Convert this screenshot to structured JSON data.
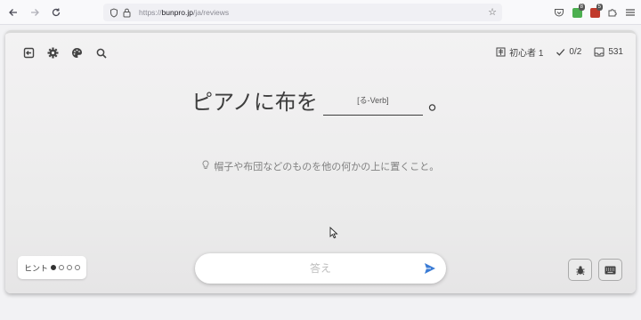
{
  "browser": {
    "url_prefix": "https://",
    "url_domain": "bunpro.jp",
    "url_path": "/ja/reviews",
    "extension_badges": [
      "8",
      "5"
    ]
  },
  "stats": {
    "level_label": "初心者 1",
    "progress": "0/2",
    "remaining": "531"
  },
  "question": {
    "before": "ピアノに布を",
    "blank_hint": "[る-Verb]",
    "after": "。",
    "translation": "帽子や布団などのものを他の何かの上に置くこと。"
  },
  "hint": {
    "label": "ヒント",
    "level_filled": 1,
    "level_total": 4
  },
  "answer": {
    "placeholder": "答え",
    "value": ""
  },
  "colors": {
    "accent_blue": "#3a7bd5",
    "ext_green": "#4caf50",
    "ext_red": "#c0392b"
  }
}
